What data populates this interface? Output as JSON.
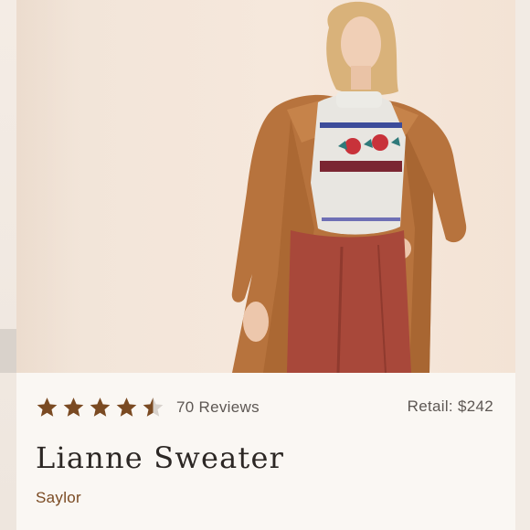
{
  "product": {
    "rating": 4.5,
    "rating_max": 5,
    "reviews_label": "70 Reviews",
    "retail_label": "Retail: $242",
    "title": "Lianne Sweater",
    "brand": "Saylor"
  },
  "colors": {
    "star_fill": "#7a4a22",
    "star_empty": "#d8d2cc",
    "brand": "#7a4a22"
  },
  "icons": [
    "star-icon",
    "half-star-icon"
  ]
}
